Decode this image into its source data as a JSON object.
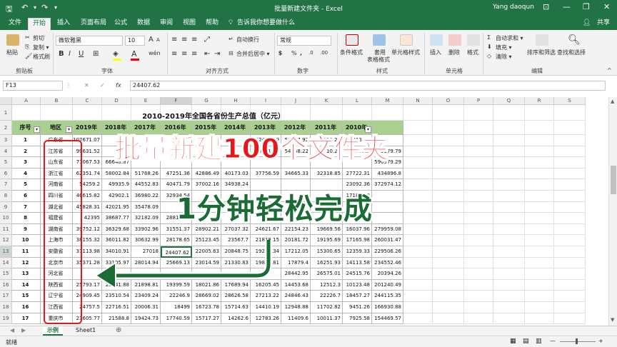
{
  "window": {
    "title": "批量新建文件夹 - Excel",
    "user": "Yang daoqun",
    "controls": {
      "minimize": "—",
      "restore": "❐",
      "close": "✕",
      "ribbon_display": "⊡"
    }
  },
  "tabs": [
    "文件",
    "开始",
    "插入",
    "页面布局",
    "公式",
    "数据",
    "审阅",
    "视图",
    "帮助",
    "告诉我你想要做什么"
  ],
  "share_label": "共享",
  "ribbon": {
    "clipboard": {
      "label": "剪贴板",
      "paste": "粘贴",
      "cut": "剪切",
      "copy": "复制 ▾",
      "format_painter": "格式刷"
    },
    "font": {
      "label": "字体",
      "name": "微软雅黑",
      "size": "10",
      "bold": "B",
      "italic": "I",
      "underline": "U",
      "grow": "A",
      "shrink": "A",
      "wen": "wén"
    },
    "alignment": {
      "label": "对齐方式",
      "wrap": "自动换行",
      "merge": "合并后居中 ▾"
    },
    "number": {
      "label": "数字",
      "format": "常规",
      "percent": "%",
      "comma": ",",
      "inc_decimal": ".0",
      "dec_decimal": ".00"
    },
    "styles": {
      "label": "样式",
      "conditional": "条件格式",
      "table_line1": "套用",
      "table_line2": "表格格式",
      "cell_styles": "单元格样式"
    },
    "cells": {
      "label": "单元格",
      "insert": "插入",
      "delete": "删除",
      "format": "格式"
    },
    "editing": {
      "label": "编辑",
      "autosum": "自动求和 ▾",
      "fill": "填充 ▾",
      "clear": "清除 ▾",
      "sort": "排序和筛选",
      "find": "查找和选择"
    }
  },
  "formula_bar": {
    "name_box": "F13",
    "fx": "fx",
    "content": "24407.62"
  },
  "columns": [
    "A",
    "B",
    "C",
    "D",
    "E",
    "F",
    "G",
    "H",
    "I",
    "J",
    "K",
    "L",
    "M",
    "N",
    "O",
    "P",
    "Q",
    "R",
    "S"
  ],
  "sheet": {
    "title": "2010-2019年全国各省份生产总值（亿元）",
    "header_seq": "序号",
    "header_region": "地区",
    "header_years": [
      "2019年",
      "2018年",
      "2017年",
      "2016年",
      "2015年",
      "2014年",
      "2013年",
      "2012年",
      "2011年",
      "2010年",
      ""
    ],
    "rows": [
      {
        "n": "1",
        "region": "广东省",
        "v": [
          "107671.07",
          "",
          "",
          "",
          "",
          "",
          "62474.79",
          "57067.92",
          "53210.28",
          "46013.06",
          ""
        ]
      },
      {
        "n": "2",
        "region": "江苏省",
        "v": [
          "99631.52",
          "",
          "",
          "",
          "",
          "",
          "59161.75",
          "54058.22",
          "49110.27",
          "41425.48",
          "609379.79"
        ]
      },
      {
        "n": "3",
        "region": "山东省",
        "v": [
          "71067.53",
          "66648.87",
          "",
          "",
          "",
          "",
          "",
          "",
          "",
          "",
          "590579.29"
        ]
      },
      {
        "n": "4",
        "region": "浙江省",
        "v": [
          "62351.74",
          "58002.84",
          "51768.26",
          "47251.36",
          "42886.49",
          "40173.03",
          "37756.59",
          "34665.33",
          "32318.85",
          "27722.31",
          "434896.8"
        ]
      },
      {
        "n": "5",
        "region": "河南省",
        "v": [
          "54259.2",
          "49935.9",
          "44552.83",
          "40471.79",
          "37002.16",
          "34938.24",
          "",
          "",
          "",
          "23092.36",
          "372974.12"
        ]
      },
      {
        "n": "6",
        "region": "四川省",
        "v": [
          "46615.82",
          "42902.1",
          "36980.22",
          "32934.54",
          "",
          "",
          "",
          "",
          "",
          "17185.48",
          ""
        ]
      },
      {
        "n": "7",
        "region": "湖北省",
        "v": [
          "45828.31",
          "42021.95",
          "35478.09",
          "",
          "",
          "",
          "",
          "",
          "",
          "",
          ""
        ]
      },
      {
        "n": "8",
        "region": "福建省",
        "v": [
          "42395",
          "38687.77",
          "32182.09",
          "28810.58",
          "",
          "",
          "",
          "",
          "",
          "",
          ""
        ]
      },
      {
        "n": "9",
        "region": "湖南省",
        "v": [
          "39752.12",
          "36329.68",
          "33902.96",
          "31551.37",
          "28902.21",
          "27037.32",
          "24621.67",
          "22154.23",
          "19669.56",
          "16037.96",
          "279959.08"
        ]
      },
      {
        "n": "10",
        "region": "上海市",
        "v": [
          "38155.32",
          "36011.82",
          "30632.99",
          "28178.65",
          "25123.45",
          "23567.7",
          "21818.15",
          "20181.72",
          "19195.69",
          "17165.98",
          "260031.47"
        ]
      },
      {
        "n": "11",
        "region": "安徽省",
        "v": [
          "37113.98",
          "34010.91",
          "27018",
          "24407.62",
          "22005.63",
          "20848.75",
          "19229.34",
          "17212.05",
          "15300.65",
          "12359.33",
          "229506.26"
        ]
      },
      {
        "n": "12",
        "region": "北京市",
        "v": [
          "35371.28",
          "33105.97",
          "28014.94",
          "25669.13",
          "23014.59",
          "21330.83",
          "19800.81",
          "17879.4",
          "16251.93",
          "14113.58",
          "234552.46"
        ]
      },
      {
        "n": "13",
        "region": "河北省",
        "v": [
          "",
          "",
          "",
          "",
          "",
          "",
          "",
          "28442.95",
          "26575.01",
          "24515.76",
          "20394.26"
        ]
      },
      {
        "n": "14",
        "region": "陕西省",
        "v": [
          "25793.17",
          "23941.88",
          "21898.81",
          "19399.59",
          "18021.86",
          "17689.94",
          "16205.45",
          "14453.68",
          "12512.3",
          "10123.48",
          "201240.49"
        ]
      },
      {
        "n": "15",
        "region": "辽宁省",
        "v": [
          "24909.45",
          "23510.54",
          "23409.24",
          "22246.9",
          "28669.02",
          "28626.58",
          "27213.22",
          "24846.43",
          "22226.7",
          "18457.27",
          "244115.35"
        ]
      },
      {
        "n": "16",
        "region": "江西省",
        "v": [
          "24757.5",
          "22716.51",
          "20006.31",
          "18499",
          "16723.78",
          "15714.63",
          "14410.19",
          "12948.88",
          "11702.82",
          "9451.26",
          "166930.88"
        ]
      },
      {
        "n": "17",
        "region": "重庆市",
        "v": [
          "23605.77",
          "21588.8",
          "19424.73",
          "17740.59",
          "15717.27",
          "14262.6",
          "12783.26",
          "11409.6",
          "10011.37",
          "7925.58",
          "154469.57"
        ]
      }
    ]
  },
  "overlay": {
    "line1": "批量新建100个文件夹",
    "line2": "1分钟轻松完成"
  },
  "sheet_tabs": [
    "示例",
    "Sheet1"
  ],
  "status": {
    "mode": "就绪",
    "view_normal": "▦",
    "view_layout": "▤",
    "view_break": "▥",
    "zoom_minus": "—",
    "zoom_plus": "+"
  },
  "colors": {
    "excel_green": "#217346",
    "header_fill": "#a9d08e",
    "overlay_red": "#e8161b",
    "overlay_green": "#1b6b35",
    "annotation_red": "#e8161b"
  }
}
